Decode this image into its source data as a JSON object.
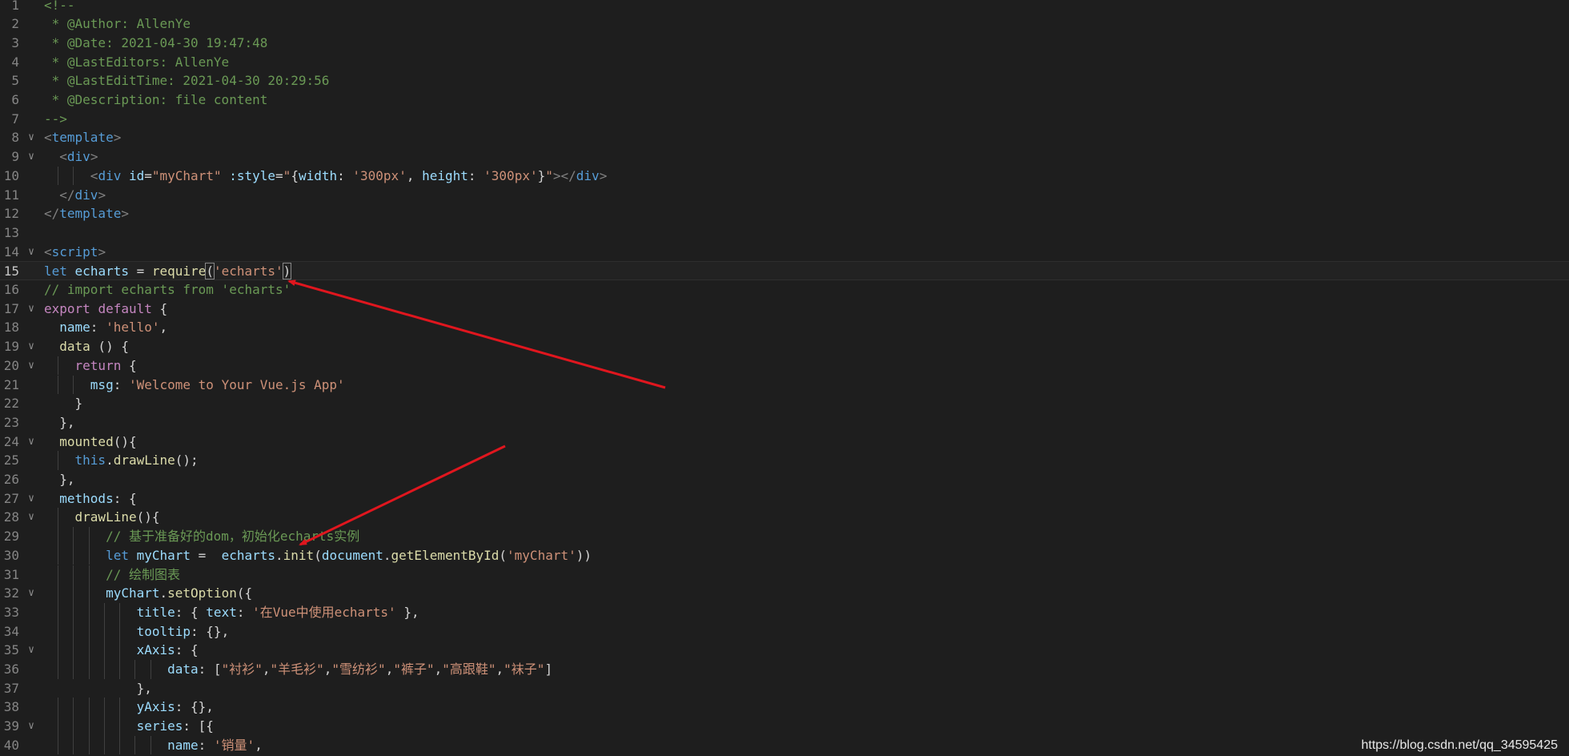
{
  "editor": {
    "lines": [
      {
        "n": "1",
        "fold": "",
        "tokens": [
          {
            "t": "<!--",
            "c": "comment"
          }
        ]
      },
      {
        "n": "2",
        "fold": "",
        "tokens": [
          {
            "t": " * @Author: AllenYe",
            "c": "comment"
          }
        ]
      },
      {
        "n": "3",
        "fold": "",
        "tokens": [
          {
            "t": " * @Date: 2021-04-30 19:47:48",
            "c": "comment"
          }
        ]
      },
      {
        "n": "4",
        "fold": "",
        "tokens": [
          {
            "t": " * @LastEditors: AllenYe",
            "c": "comment"
          }
        ]
      },
      {
        "n": "5",
        "fold": "",
        "tokens": [
          {
            "t": " * @LastEditTime: 2021-04-30 20:29:56",
            "c": "comment"
          }
        ]
      },
      {
        "n": "6",
        "fold": "",
        "tokens": [
          {
            "t": " * @Description: file content",
            "c": "comment"
          }
        ]
      },
      {
        "n": "7",
        "fold": "",
        "tokens": [
          {
            "t": "-->",
            "c": "comment"
          }
        ]
      },
      {
        "n": "8",
        "fold": "∨",
        "tokens": [
          {
            "t": "<",
            "c": "tagpunct"
          },
          {
            "t": "template",
            "c": "tag"
          },
          {
            "t": ">",
            "c": "tagpunct"
          }
        ]
      },
      {
        "n": "9",
        "fold": "∨",
        "tokens": [
          {
            "t": "  ",
            "c": "plain"
          },
          {
            "t": "<",
            "c": "tagpunct"
          },
          {
            "t": "div",
            "c": "tag"
          },
          {
            "t": ">",
            "c": "tagpunct"
          }
        ]
      },
      {
        "n": "10",
        "fold": "",
        "tokens": [
          {
            "t": "      ",
            "c": "plain"
          },
          {
            "t": "<",
            "c": "tagpunct"
          },
          {
            "t": "div",
            "c": "tag"
          },
          {
            "t": " ",
            "c": "plain"
          },
          {
            "t": "id",
            "c": "attr"
          },
          {
            "t": "=",
            "c": "plain"
          },
          {
            "t": "\"myChart\"",
            "c": "str"
          },
          {
            "t": " ",
            "c": "plain"
          },
          {
            "t": ":style",
            "c": "attr"
          },
          {
            "t": "=",
            "c": "plain"
          },
          {
            "t": "\"",
            "c": "str"
          },
          {
            "t": "{",
            "c": "plain"
          },
          {
            "t": "width",
            "c": "attr"
          },
          {
            "t": ": ",
            "c": "plain"
          },
          {
            "t": "'300px'",
            "c": "str"
          },
          {
            "t": ", ",
            "c": "plain"
          },
          {
            "t": "height",
            "c": "attr"
          },
          {
            "t": ": ",
            "c": "plain"
          },
          {
            "t": "'300px'",
            "c": "str"
          },
          {
            "t": "}",
            "c": "plain"
          },
          {
            "t": "\"",
            "c": "str"
          },
          {
            "t": "></",
            "c": "tagpunct"
          },
          {
            "t": "div",
            "c": "tag"
          },
          {
            "t": ">",
            "c": "tagpunct"
          }
        ]
      },
      {
        "n": "11",
        "fold": "",
        "tokens": [
          {
            "t": "  ",
            "c": "plain"
          },
          {
            "t": "</",
            "c": "tagpunct"
          },
          {
            "t": "div",
            "c": "tag"
          },
          {
            "t": ">",
            "c": "tagpunct"
          }
        ]
      },
      {
        "n": "12",
        "fold": "",
        "tokens": [
          {
            "t": "</",
            "c": "tagpunct"
          },
          {
            "t": "template",
            "c": "tag"
          },
          {
            "t": ">",
            "c": "tagpunct"
          }
        ]
      },
      {
        "n": "13",
        "fold": "",
        "tokens": []
      },
      {
        "n": "14",
        "fold": "∨",
        "tokens": [
          {
            "t": "<",
            "c": "tagpunct"
          },
          {
            "t": "script",
            "c": "tag"
          },
          {
            "t": ">",
            "c": "tagpunct"
          }
        ]
      },
      {
        "n": "15",
        "fold": "",
        "current": true,
        "tokens": [
          {
            "t": "let",
            "c": "kw"
          },
          {
            "t": " ",
            "c": "plain"
          },
          {
            "t": "echarts",
            "c": "var"
          },
          {
            "t": " = ",
            "c": "plain"
          },
          {
            "t": "require",
            "c": "fn"
          },
          {
            "t": "(",
            "c": "plain",
            "hl": true
          },
          {
            "t": "'echarts'",
            "c": "str"
          },
          {
            "t": ")",
            "c": "plain",
            "hl": true
          }
        ]
      },
      {
        "n": "16",
        "fold": "",
        "tokens": [
          {
            "t": "// import echarts from 'echarts'",
            "c": "comment"
          }
        ]
      },
      {
        "n": "17",
        "fold": "∨",
        "tokens": [
          {
            "t": "export",
            "c": "kwc"
          },
          {
            "t": " ",
            "c": "plain"
          },
          {
            "t": "default",
            "c": "kwc"
          },
          {
            "t": " {",
            "c": "plain"
          }
        ]
      },
      {
        "n": "18",
        "fold": "",
        "tokens": [
          {
            "t": "  ",
            "c": "plain"
          },
          {
            "t": "name",
            "c": "var"
          },
          {
            "t": ": ",
            "c": "plain"
          },
          {
            "t": "'hello'",
            "c": "str"
          },
          {
            "t": ",",
            "c": "plain"
          }
        ]
      },
      {
        "n": "19",
        "fold": "∨",
        "tokens": [
          {
            "t": "  ",
            "c": "plain"
          },
          {
            "t": "data",
            "c": "fn"
          },
          {
            "t": " () {",
            "c": "plain"
          }
        ]
      },
      {
        "n": "20",
        "fold": "∨",
        "tokens": [
          {
            "t": "    ",
            "c": "plain"
          },
          {
            "t": "return",
            "c": "kwc"
          },
          {
            "t": " {",
            "c": "plain"
          }
        ]
      },
      {
        "n": "21",
        "fold": "",
        "tokens": [
          {
            "t": "      ",
            "c": "plain"
          },
          {
            "t": "msg",
            "c": "var"
          },
          {
            "t": ": ",
            "c": "plain"
          },
          {
            "t": "'Welcome to Your Vue.js App'",
            "c": "str"
          }
        ]
      },
      {
        "n": "22",
        "fold": "",
        "tokens": [
          {
            "t": "    }",
            "c": "plain"
          }
        ]
      },
      {
        "n": "23",
        "fold": "",
        "tokens": [
          {
            "t": "  },",
            "c": "plain"
          }
        ]
      },
      {
        "n": "24",
        "fold": "∨",
        "tokens": [
          {
            "t": "  ",
            "c": "plain"
          },
          {
            "t": "mounted",
            "c": "fn"
          },
          {
            "t": "(){",
            "c": "plain"
          }
        ]
      },
      {
        "n": "25",
        "fold": "",
        "tokens": [
          {
            "t": "    ",
            "c": "plain"
          },
          {
            "t": "this",
            "c": "kw"
          },
          {
            "t": ".",
            "c": "plain"
          },
          {
            "t": "drawLine",
            "c": "fn"
          },
          {
            "t": "();",
            "c": "plain"
          }
        ]
      },
      {
        "n": "26",
        "fold": "",
        "tokens": [
          {
            "t": "  },",
            "c": "plain"
          }
        ]
      },
      {
        "n": "27",
        "fold": "∨",
        "tokens": [
          {
            "t": "  ",
            "c": "plain"
          },
          {
            "t": "methods",
            "c": "var"
          },
          {
            "t": ": {",
            "c": "plain"
          }
        ]
      },
      {
        "n": "28",
        "fold": "∨",
        "tokens": [
          {
            "t": "    ",
            "c": "plain"
          },
          {
            "t": "drawLine",
            "c": "fn"
          },
          {
            "t": "(){",
            "c": "plain"
          }
        ]
      },
      {
        "n": "29",
        "fold": "",
        "tokens": [
          {
            "t": "        ",
            "c": "plain"
          },
          {
            "t": "// 基于准备好的dom，初始化echarts实例",
            "c": "comment"
          }
        ]
      },
      {
        "n": "30",
        "fold": "",
        "tokens": [
          {
            "t": "        ",
            "c": "plain"
          },
          {
            "t": "let",
            "c": "kw"
          },
          {
            "t": " ",
            "c": "plain"
          },
          {
            "t": "myChart",
            "c": "var"
          },
          {
            "t": " =  ",
            "c": "plain"
          },
          {
            "t": "echarts",
            "c": "var"
          },
          {
            "t": ".",
            "c": "plain"
          },
          {
            "t": "init",
            "c": "fn"
          },
          {
            "t": "(",
            "c": "plain"
          },
          {
            "t": "document",
            "c": "var"
          },
          {
            "t": ".",
            "c": "plain"
          },
          {
            "t": "getElementById",
            "c": "fn"
          },
          {
            "t": "(",
            "c": "plain"
          },
          {
            "t": "'myChart'",
            "c": "str"
          },
          {
            "t": "))",
            "c": "plain"
          }
        ]
      },
      {
        "n": "31",
        "fold": "",
        "tokens": [
          {
            "t": "        ",
            "c": "plain"
          },
          {
            "t": "// 绘制图表",
            "c": "comment"
          }
        ]
      },
      {
        "n": "32",
        "fold": "∨",
        "tokens": [
          {
            "t": "        ",
            "c": "plain"
          },
          {
            "t": "myChart",
            "c": "var"
          },
          {
            "t": ".",
            "c": "plain"
          },
          {
            "t": "setOption",
            "c": "fn"
          },
          {
            "t": "({",
            "c": "plain"
          }
        ]
      },
      {
        "n": "33",
        "fold": "",
        "tokens": [
          {
            "t": "            ",
            "c": "plain"
          },
          {
            "t": "title",
            "c": "var"
          },
          {
            "t": ": { ",
            "c": "plain"
          },
          {
            "t": "text",
            "c": "var"
          },
          {
            "t": ": ",
            "c": "plain"
          },
          {
            "t": "'在Vue中使用echarts'",
            "c": "str"
          },
          {
            "t": " },",
            "c": "plain"
          }
        ]
      },
      {
        "n": "34",
        "fold": "",
        "tokens": [
          {
            "t": "            ",
            "c": "plain"
          },
          {
            "t": "tooltip",
            "c": "var"
          },
          {
            "t": ": {},",
            "c": "plain"
          }
        ]
      },
      {
        "n": "35",
        "fold": "∨",
        "tokens": [
          {
            "t": "            ",
            "c": "plain"
          },
          {
            "t": "xAxis",
            "c": "var"
          },
          {
            "t": ": {",
            "c": "plain"
          }
        ]
      },
      {
        "n": "36",
        "fold": "",
        "tokens": [
          {
            "t": "                ",
            "c": "plain"
          },
          {
            "t": "data",
            "c": "var"
          },
          {
            "t": ": [",
            "c": "plain"
          },
          {
            "t": "\"衬衫\"",
            "c": "str"
          },
          {
            "t": ",",
            "c": "plain"
          },
          {
            "t": "\"羊毛衫\"",
            "c": "str"
          },
          {
            "t": ",",
            "c": "plain"
          },
          {
            "t": "\"雪纺衫\"",
            "c": "str"
          },
          {
            "t": ",",
            "c": "plain"
          },
          {
            "t": "\"裤子\"",
            "c": "str"
          },
          {
            "t": ",",
            "c": "plain"
          },
          {
            "t": "\"高跟鞋\"",
            "c": "str"
          },
          {
            "t": ",",
            "c": "plain"
          },
          {
            "t": "\"袜子\"",
            "c": "str"
          },
          {
            "t": "]",
            "c": "plain"
          }
        ]
      },
      {
        "n": "37",
        "fold": "",
        "tokens": [
          {
            "t": "            },",
            "c": "plain"
          }
        ]
      },
      {
        "n": "38",
        "fold": "",
        "tokens": [
          {
            "t": "            ",
            "c": "plain"
          },
          {
            "t": "yAxis",
            "c": "var"
          },
          {
            "t": ": {},",
            "c": "plain"
          }
        ]
      },
      {
        "n": "39",
        "fold": "∨",
        "tokens": [
          {
            "t": "            ",
            "c": "plain"
          },
          {
            "t": "series",
            "c": "var"
          },
          {
            "t": ": [{",
            "c": "plain"
          }
        ]
      },
      {
        "n": "40",
        "fold": "",
        "tokens": [
          {
            "t": "                ",
            "c": "plain"
          },
          {
            "t": "name",
            "c": "var"
          },
          {
            "t": ": ",
            "c": "plain"
          },
          {
            "t": "'销量'",
            "c": "str"
          },
          {
            "t": ",",
            "c": "plain"
          }
        ]
      }
    ]
  },
  "colors": {
    "background": "#1e1e1e",
    "annotation_arrow": "#e0161e"
  },
  "watermark": {
    "text": "https://blog.csdn.net/qq_34595425"
  }
}
